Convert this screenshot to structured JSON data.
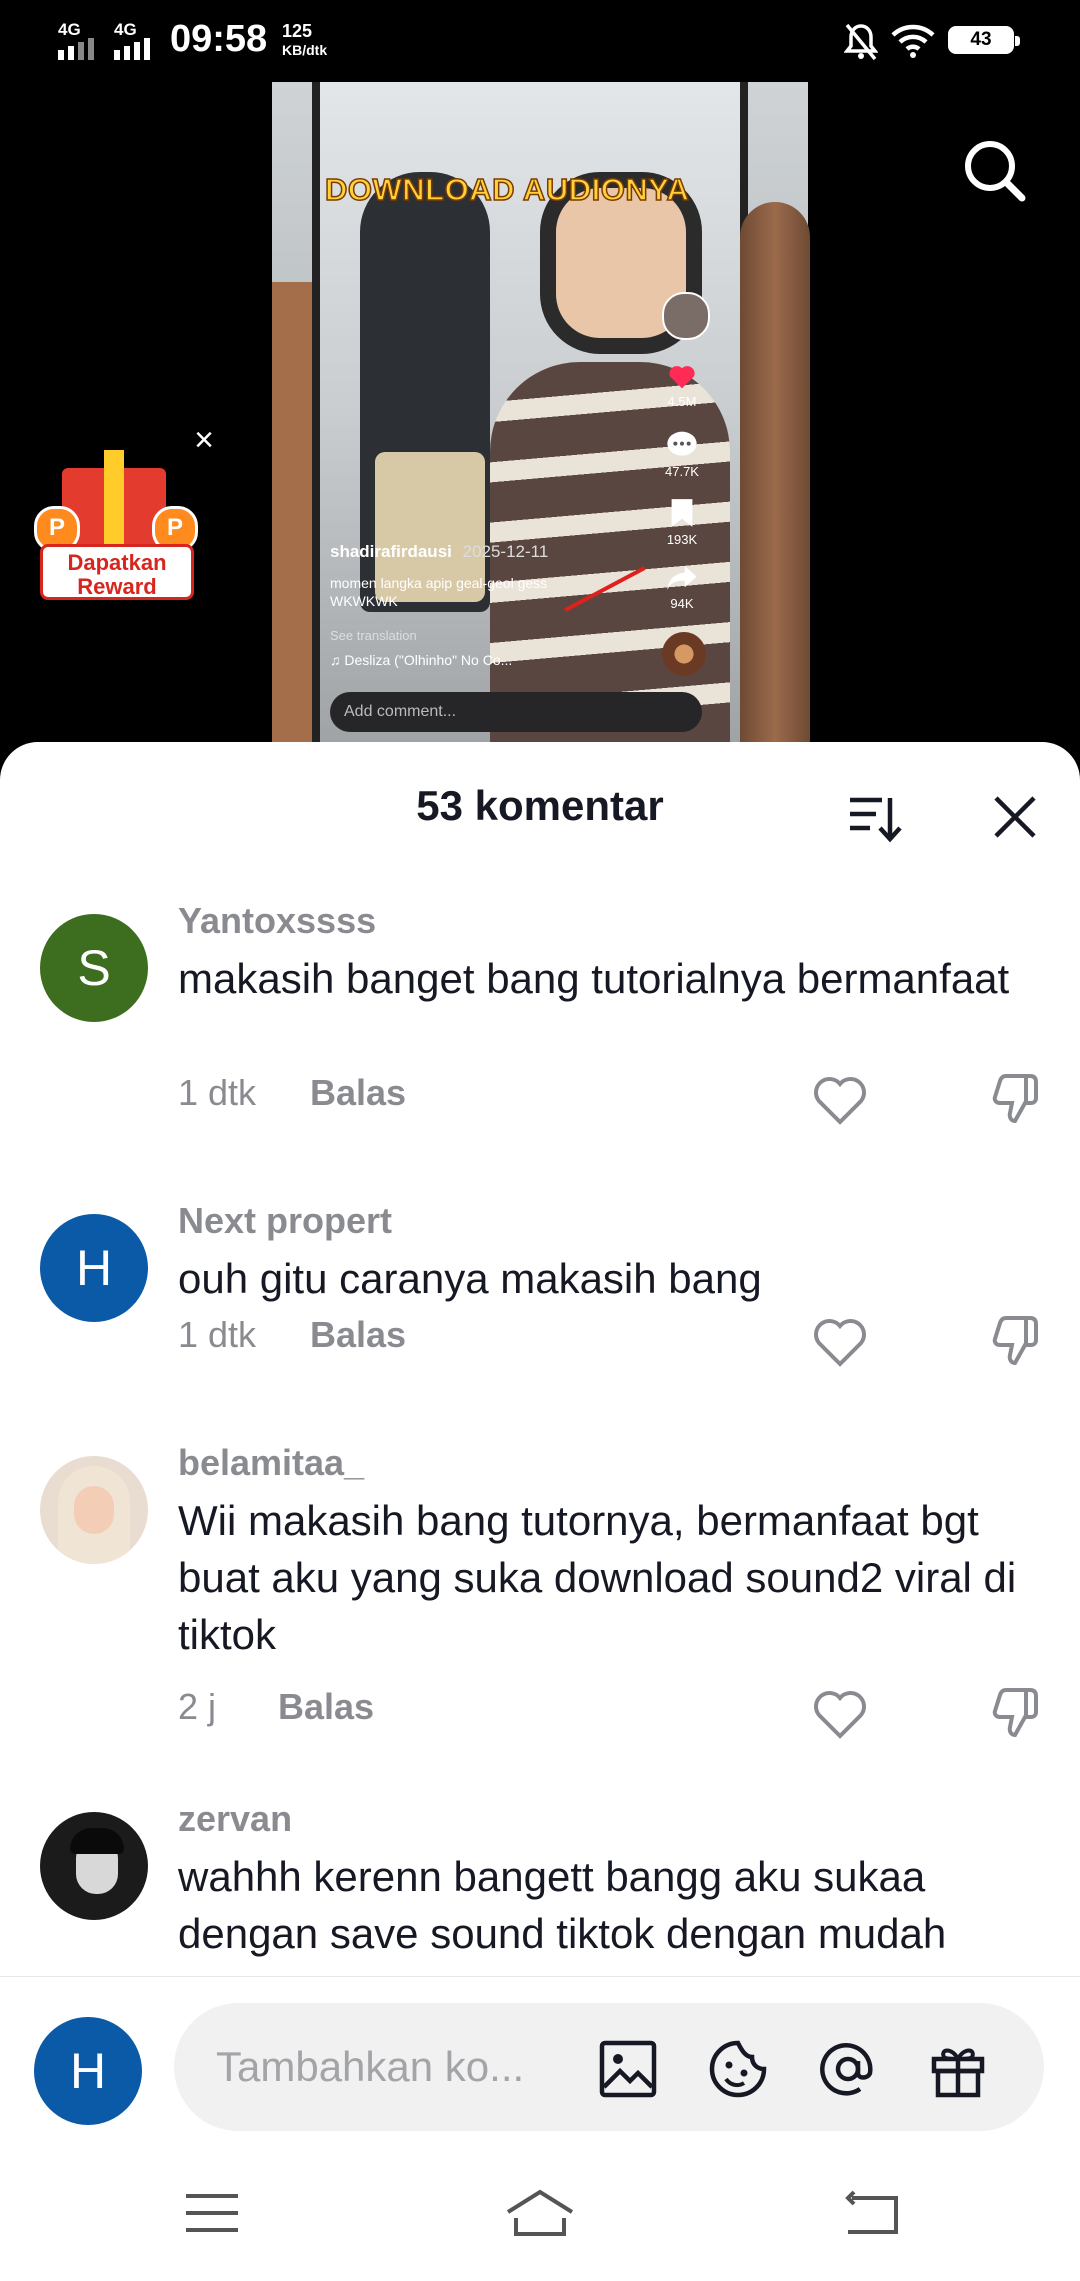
{
  "status_bar": {
    "signal1": "4G",
    "signal2": "4G",
    "time": "09:58",
    "speed_value": "125",
    "speed_unit": "KB/dtk",
    "battery": "43"
  },
  "video": {
    "overlay_text": "DOWNLOAD AUDIONYA",
    "likes": "4.5M",
    "comments": "47.7K",
    "saves": "193K",
    "shares": "94K",
    "username": "shadirafirdausi",
    "date": "2025-12-11",
    "description": "momen langka apip geal-geol gess WKWKWK",
    "see_translation": "See translation",
    "music": "♫ Desliza (\"Olhinho\" No Co...",
    "add_comment": "Add comment..."
  },
  "reward": {
    "label_line1": "Dapatkan",
    "label_line2": "Reward"
  },
  "sheet": {
    "title": "53 komentar"
  },
  "comments": [
    {
      "initial": "S",
      "avatar_color": "#3d6e1f",
      "username": "Yantoxssss",
      "text": "makasih banget bang tutorialnya bermanfaat",
      "time": "1 dtk",
      "reply": "Balas"
    },
    {
      "initial": "H",
      "avatar_color": "#0b5aa7",
      "username": "Next propert",
      "text": "ouh gitu caranya makasih bang",
      "time": "1 dtk",
      "reply": "Balas"
    },
    {
      "initial": "",
      "avatar_color": "#e9ddd2",
      "username": "belamitaa_",
      "text": "Wii makasih bang tutornya, bermanfaat bgt buat aku yang suka download sound2 viral di tiktok",
      "time": "2 j",
      "reply": "Balas"
    },
    {
      "initial": "",
      "avatar_color": "#1b1b1b",
      "username": "zervan",
      "text": "wahhh kerenn bangett bangg aku sukaa dengan save sound tiktok dengan mudah",
      "time": "",
      "reply": ""
    }
  ],
  "composer": {
    "avatar_initial": "H",
    "placeholder": "Tambahkan ko..."
  },
  "icons": {
    "search": "search-icon",
    "sort": "sort-icon",
    "close": "close-icon",
    "like": "heart-icon",
    "dislike": "dislike-icon",
    "image": "image-icon",
    "emoji": "emoji-icon",
    "mention": "at-icon",
    "gift": "gift-icon"
  }
}
